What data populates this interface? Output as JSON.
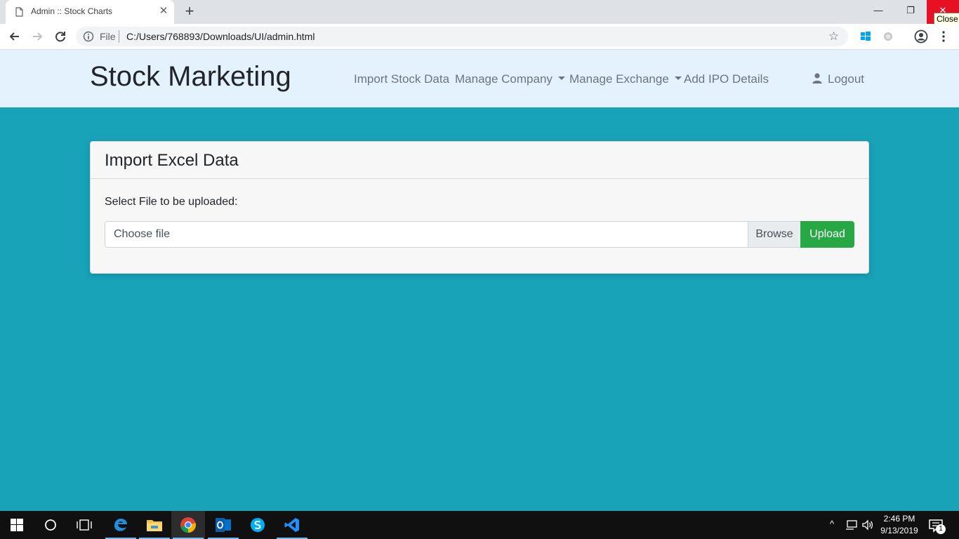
{
  "browser": {
    "tab_title": "Admin :: Stock Charts",
    "tab_close_glyph": "✕",
    "new_tab_glyph": "+",
    "window_min_glyph": "—",
    "window_max_glyph": "❐",
    "window_close_glyph": "✕",
    "close_tooltip": "Close",
    "omnibox_scheme": "File",
    "url": "C:/Users/768893/Downloads/UI/admin.html",
    "star_glyph": "☆"
  },
  "navbar": {
    "brand": "Stock Marketing",
    "items": [
      {
        "label": "Import Stock Data",
        "dropdown": false
      },
      {
        "label": "Manage Company",
        "dropdown": true
      },
      {
        "label": "Manage Exchange",
        "dropdown": true
      },
      {
        "label": "Add IPO Details",
        "dropdown": false
      }
    ],
    "logout_label": "Logout"
  },
  "card": {
    "title": "Import Excel Data",
    "field_label": "Select File to be uploaded:",
    "file_placeholder": "Choose file",
    "browse_label": "Browse",
    "upload_label": "Upload"
  },
  "taskbar": {
    "time": "2:46 PM",
    "date": "9/13/2019",
    "notification_count": "1",
    "tray_up_glyph": "^"
  },
  "colors": {
    "page_background": "#17a2b8",
    "navbar_background": "#e3f2fd",
    "upload_button": "#28a745",
    "close_button": "#e81123",
    "taskbar": "#101010"
  },
  "icons": [
    "document-icon",
    "back-arrow-icon",
    "forward-arrow-icon",
    "reload-icon",
    "info-icon",
    "star-icon",
    "windows-extension-icon",
    "extension-icon",
    "profile-icon",
    "menu-dots-icon",
    "user-icon",
    "windows-start-icon",
    "search-circle-icon",
    "task-view-icon",
    "edge-icon",
    "file-explorer-icon",
    "chrome-icon",
    "outlook-icon",
    "skype-icon",
    "vscode-icon",
    "network-icon",
    "volume-icon",
    "notification-icon"
  ]
}
